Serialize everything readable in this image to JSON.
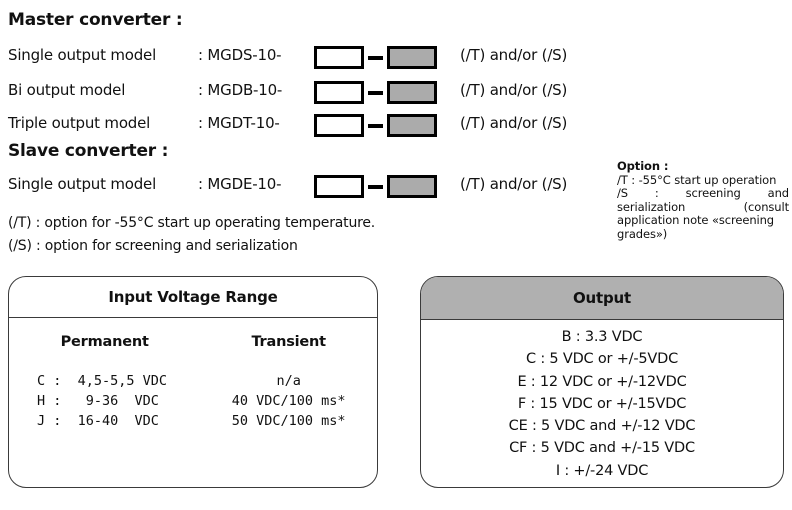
{
  "master": {
    "title": "Master converter :",
    "rows": [
      {
        "label": "Single output model",
        "code": ": MGDS-10-",
        "option": "(/T) and/or (/S)"
      },
      {
        "label": "Bi output model",
        "code": ": MGDB-10-",
        "option": "(/T) and/or (/S)"
      },
      {
        "label": "Triple output model",
        "code": ": MGDT-10-",
        "option": "(/T) and/or (/S)"
      }
    ]
  },
  "slave": {
    "title": "Slave converter :",
    "rows": [
      {
        "label": "Single output model",
        "code": ": MGDE-10-",
        "option": "(/T) and/or (/S)"
      }
    ]
  },
  "footnotes": [
    "(/T) : option for -55°C start up operating temperature.",
    "(/S) : option for screening and serialization"
  ],
  "option_note": {
    "heading": "Option :",
    "line1": "/T : -55°C start up operation",
    "line2": "/S : screening and",
    "line3": "serialization (consult",
    "line4": "application note «screening",
    "line5": "grades»)"
  },
  "input_voltage": {
    "title": "Input Voltage Range",
    "col_permanent": "Permanent",
    "col_transient": "Transient",
    "rows": [
      {
        "permanent": "C :  4,5-5,5 VDC",
        "transient": "n/a"
      },
      {
        "permanent": "H :   9-36  VDC",
        "transient": "40 VDC/100 ms*"
      },
      {
        "permanent": "J :  16-40  VDC",
        "transient": "50 VDC/100 ms*"
      }
    ]
  },
  "output": {
    "title": "Output",
    "items": [
      "B : 3.3 VDC",
      "C : 5 VDC or +/-5VDC",
      "E : 12 VDC or +/-12VDC",
      "F : 15 VDC or +/-15VDC",
      "CE : 5 VDC and +/-12 VDC",
      "CF : 5 VDC and +/-15 VDC",
      "I : +/-24 VDC"
    ]
  },
  "colors": {
    "fill_gray": "#ababab",
    "header_gray": "#b0b0b0",
    "border": "#3a3a3a",
    "text": "#111111"
  }
}
